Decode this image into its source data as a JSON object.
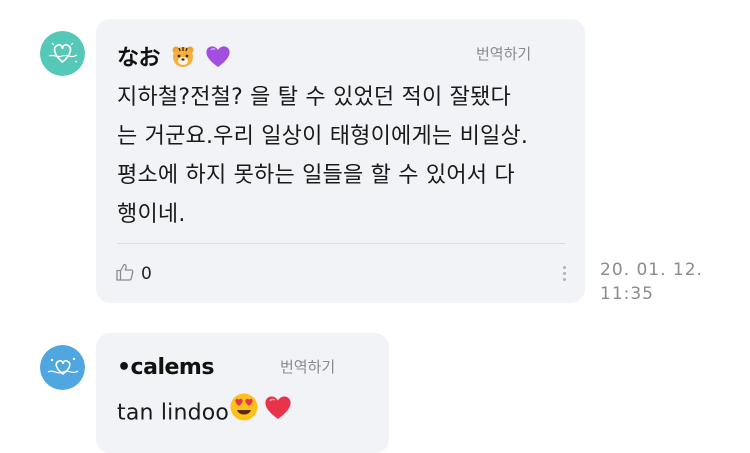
{
  "comments": [
    {
      "author": "なお",
      "author_emojis": [
        "tiger-face-emoji",
        "purple-heart-emoji"
      ],
      "translate_label": "번역하기",
      "body_lines": [
        "지하철?전철? 을 탈 수 있었던 적이 잘됐다",
        "는 거군요.우리 일상이 태형이에게는 비일상.",
        "평소에 하지 못하는 일들을 할 수 있어서 다",
        "행이네."
      ],
      "like_count": "0",
      "timestamp_date": "20. 01. 12.",
      "timestamp_time": "11:35",
      "avatar_icon": "heart-doodle-avatar-icon",
      "avatar_color": "#56c8b8"
    },
    {
      "author": "•calems",
      "translate_label": "번역하기",
      "body_text": "tan lindoo",
      "body_emojis": [
        "heart-eyes-emoji",
        "red-heart-emoji"
      ],
      "avatar_icon": "heart-doodle-avatar-icon",
      "avatar_color": "#4fa6e0"
    }
  ],
  "icons": {
    "like": "thumbs-up-icon",
    "more": "more-vertical-icon"
  },
  "colors": {
    "bubble_bg": "#f2f3f7",
    "muted_text": "#8a8a8f"
  }
}
